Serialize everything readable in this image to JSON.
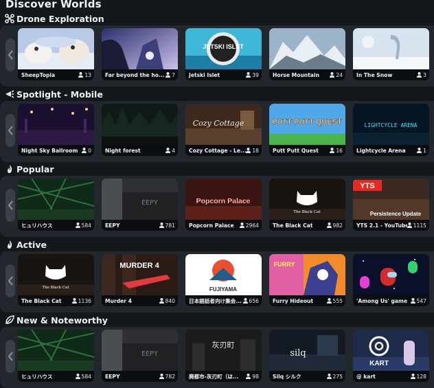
{
  "page": {
    "title": "Discover Worlds"
  },
  "sections": [
    {
      "title": "Drone Exploration",
      "icon": "drone-icon",
      "worlds": [
        {
          "name": "SheepTopia",
          "count": "13"
        },
        {
          "name": "Far beyond the ho...",
          "count": "7"
        },
        {
          "name": "Jetski Islet",
          "count": "39",
          "thumb_text": "JETSKI ISLET"
        },
        {
          "name": "Horse Mountain",
          "count": "24"
        },
        {
          "name": "In The Snow",
          "count": "3"
        }
      ]
    },
    {
      "title": "Spotlight - Mobile",
      "icon": "spotlight-icon",
      "worlds": [
        {
          "name": "Night Sky Ballroom",
          "count": "0"
        },
        {
          "name": "Night forest",
          "count": "4"
        },
        {
          "name": "Cozy Cottage - Le...",
          "count": "18",
          "thumb_text": "Cozy Cottage"
        },
        {
          "name": "Putt Putt Quest",
          "count": "16",
          "thumb_text": "PUTT PUTT QUEST"
        },
        {
          "name": "Lightcycle Arena",
          "count": "1",
          "thumb_text": "LIGHTCYCLE ARENA"
        }
      ]
    },
    {
      "title": "Popular",
      "icon": "flame-icon",
      "worlds": [
        {
          "name": "ヒュリハウス",
          "count": "584"
        },
        {
          "name": "EEPY",
          "count": "781",
          "thumb_text": "EEPY"
        },
        {
          "name": "Popcorn Palace",
          "count": "2964",
          "thumb_text": "Popcorn Palace"
        },
        {
          "name": "The Black Cat",
          "count": "982",
          "thumb_text": "The Black Cat"
        },
        {
          "name": "YTS 2.1 - YouTube...",
          "count": "1115",
          "thumb_text": "Persistence Update",
          "thumb_badge": "YTS"
        }
      ]
    },
    {
      "title": "Active",
      "icon": "flame-icon",
      "worlds": [
        {
          "name": "The Black Cat",
          "count": "1136",
          "thumb_text": "The Black Cat"
        },
        {
          "name": "Murder 4",
          "count": "840",
          "thumb_text": "MURDER 4"
        },
        {
          "name": "日本語話者向け集会...",
          "count": "656",
          "thumb_text": "FUJIYAMA"
        },
        {
          "name": "Furry Hideout",
          "count": "555",
          "thumb_text": "FURRY"
        },
        {
          "name": "'Among Us' game",
          "count": "547"
        }
      ]
    },
    {
      "title": "New & Noteworthy",
      "icon": "leaf-icon",
      "worlds": [
        {
          "name": "ヒュリハウス",
          "count": "584"
        },
        {
          "name": "EEPY",
          "count": "782",
          "thumb_text": "EEPY"
        },
        {
          "name": "廃都市-灰刃町（は...",
          "count": "98",
          "thumb_text": "灰刃町"
        },
        {
          "name": "Silq シルク",
          "count": "275",
          "thumb_text": "silq"
        },
        {
          "name": "@ kart",
          "count": "128",
          "thumb_text": "KART"
        }
      ]
    }
  ]
}
